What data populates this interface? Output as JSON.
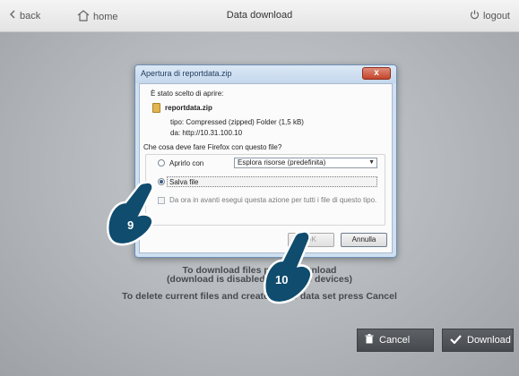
{
  "topbar": {
    "back_label": "back",
    "home_label": "home",
    "title": "Data download",
    "logout_label": "logout"
  },
  "main": {
    "info_line1": "To download files press Download",
    "info_line2": "(download is disabled on mobile devices)",
    "info_line3": "To delete current files and create a new data set press Cancel",
    "cancel_label": "Cancel",
    "download_label": "Download"
  },
  "dialog": {
    "title": "Apertura di reportdata.zip",
    "close_label": "x",
    "opened_text": "È stato scelto di aprire:",
    "file_name": "reportdata.zip",
    "type_text": "tipo: Compressed (zipped) Folder (1,5 kB)",
    "from_text": "da: http://10.31.100.10",
    "question": "Che cosa deve fare Firefox con questo file?",
    "open_with_label": "Aprirlo con",
    "open_with_value": "Esplora risorse (predefinita)",
    "save_label": "Salva file",
    "always_label": "Da ora in avanti esegui questa azione per tutti i file di questo tipo.",
    "ok_label": "OK",
    "cancel_label": "Annulla"
  },
  "callouts": {
    "step_a": "9",
    "step_b": "10"
  },
  "colors": {
    "accent_dark": "#474a4e",
    "dialog_frame": "#cfe0f1",
    "close_red": "#c4452b"
  },
  "icons": [
    "chevron-left-icon",
    "home-icon",
    "power-icon",
    "trash-icon",
    "checkmark-icon",
    "zip-file-icon",
    "hand-pointer-icon"
  ]
}
